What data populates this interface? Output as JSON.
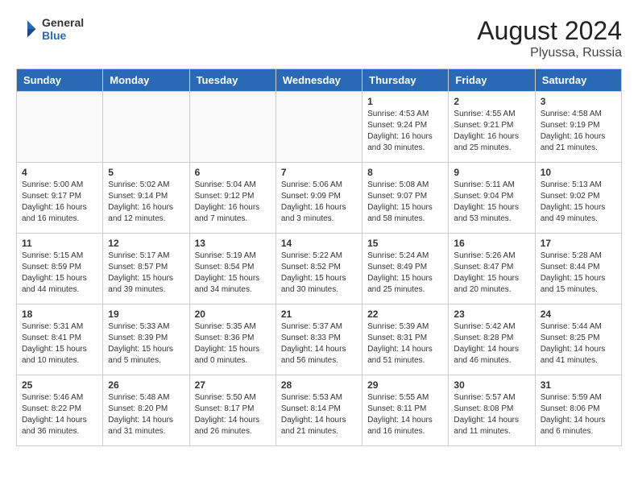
{
  "header": {
    "logo_general": "General",
    "logo_blue": "Blue",
    "month_year": "August 2024",
    "location": "Plyussa, Russia"
  },
  "days_of_week": [
    "Sunday",
    "Monday",
    "Tuesday",
    "Wednesday",
    "Thursday",
    "Friday",
    "Saturday"
  ],
  "weeks": [
    [
      {
        "day": "",
        "info": ""
      },
      {
        "day": "",
        "info": ""
      },
      {
        "day": "",
        "info": ""
      },
      {
        "day": "",
        "info": ""
      },
      {
        "day": "1",
        "sunrise": "4:53 AM",
        "sunset": "9:24 PM",
        "daylight": "16 hours and 30 minutes"
      },
      {
        "day": "2",
        "sunrise": "4:55 AM",
        "sunset": "9:21 PM",
        "daylight": "16 hours and 25 minutes"
      },
      {
        "day": "3",
        "sunrise": "4:58 AM",
        "sunset": "9:19 PM",
        "daylight": "16 hours and 21 minutes"
      }
    ],
    [
      {
        "day": "4",
        "sunrise": "5:00 AM",
        "sunset": "9:17 PM",
        "daylight": "16 hours and 16 minutes"
      },
      {
        "day": "5",
        "sunrise": "5:02 AM",
        "sunset": "9:14 PM",
        "daylight": "16 hours and 12 minutes"
      },
      {
        "day": "6",
        "sunrise": "5:04 AM",
        "sunset": "9:12 PM",
        "daylight": "16 hours and 7 minutes"
      },
      {
        "day": "7",
        "sunrise": "5:06 AM",
        "sunset": "9:09 PM",
        "daylight": "16 hours and 3 minutes"
      },
      {
        "day": "8",
        "sunrise": "5:08 AM",
        "sunset": "9:07 PM",
        "daylight": "15 hours and 58 minutes"
      },
      {
        "day": "9",
        "sunrise": "5:11 AM",
        "sunset": "9:04 PM",
        "daylight": "15 hours and 53 minutes"
      },
      {
        "day": "10",
        "sunrise": "5:13 AM",
        "sunset": "9:02 PM",
        "daylight": "15 hours and 49 minutes"
      }
    ],
    [
      {
        "day": "11",
        "sunrise": "5:15 AM",
        "sunset": "8:59 PM",
        "daylight": "15 hours and 44 minutes"
      },
      {
        "day": "12",
        "sunrise": "5:17 AM",
        "sunset": "8:57 PM",
        "daylight": "15 hours and 39 minutes"
      },
      {
        "day": "13",
        "sunrise": "5:19 AM",
        "sunset": "8:54 PM",
        "daylight": "15 hours and 34 minutes"
      },
      {
        "day": "14",
        "sunrise": "5:22 AM",
        "sunset": "8:52 PM",
        "daylight": "15 hours and 30 minutes"
      },
      {
        "day": "15",
        "sunrise": "5:24 AM",
        "sunset": "8:49 PM",
        "daylight": "15 hours and 25 minutes"
      },
      {
        "day": "16",
        "sunrise": "5:26 AM",
        "sunset": "8:47 PM",
        "daylight": "15 hours and 20 minutes"
      },
      {
        "day": "17",
        "sunrise": "5:28 AM",
        "sunset": "8:44 PM",
        "daylight": "15 hours and 15 minutes"
      }
    ],
    [
      {
        "day": "18",
        "sunrise": "5:31 AM",
        "sunset": "8:41 PM",
        "daylight": "15 hours and 10 minutes"
      },
      {
        "day": "19",
        "sunrise": "5:33 AM",
        "sunset": "8:39 PM",
        "daylight": "15 hours and 5 minutes"
      },
      {
        "day": "20",
        "sunrise": "5:35 AM",
        "sunset": "8:36 PM",
        "daylight": "15 hours and 0 minutes"
      },
      {
        "day": "21",
        "sunrise": "5:37 AM",
        "sunset": "8:33 PM",
        "daylight": "14 hours and 56 minutes"
      },
      {
        "day": "22",
        "sunrise": "5:39 AM",
        "sunset": "8:31 PM",
        "daylight": "14 hours and 51 minutes"
      },
      {
        "day": "23",
        "sunrise": "5:42 AM",
        "sunset": "8:28 PM",
        "daylight": "14 hours and 46 minutes"
      },
      {
        "day": "24",
        "sunrise": "5:44 AM",
        "sunset": "8:25 PM",
        "daylight": "14 hours and 41 minutes"
      }
    ],
    [
      {
        "day": "25",
        "sunrise": "5:46 AM",
        "sunset": "8:22 PM",
        "daylight": "14 hours and 36 minutes"
      },
      {
        "day": "26",
        "sunrise": "5:48 AM",
        "sunset": "8:20 PM",
        "daylight": "14 hours and 31 minutes"
      },
      {
        "day": "27",
        "sunrise": "5:50 AM",
        "sunset": "8:17 PM",
        "daylight": "14 hours and 26 minutes"
      },
      {
        "day": "28",
        "sunrise": "5:53 AM",
        "sunset": "8:14 PM",
        "daylight": "14 hours and 21 minutes"
      },
      {
        "day": "29",
        "sunrise": "5:55 AM",
        "sunset": "8:11 PM",
        "daylight": "14 hours and 16 minutes"
      },
      {
        "day": "30",
        "sunrise": "5:57 AM",
        "sunset": "8:08 PM",
        "daylight": "14 hours and 11 minutes"
      },
      {
        "day": "31",
        "sunrise": "5:59 AM",
        "sunset": "8:06 PM",
        "daylight": "14 hours and 6 minutes"
      }
    ]
  ]
}
